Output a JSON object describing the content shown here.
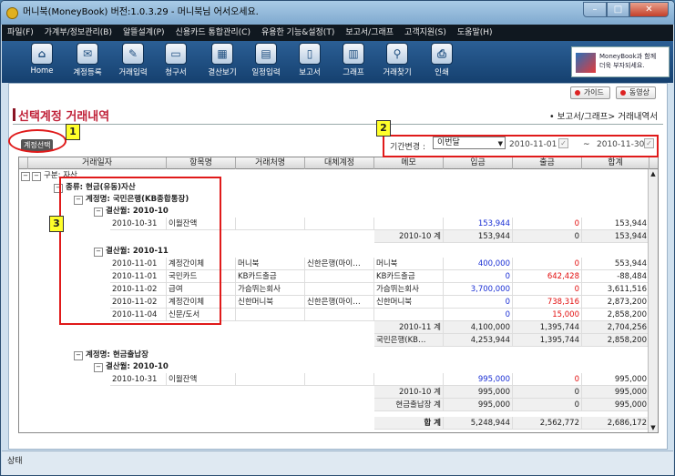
{
  "window": {
    "title": "머니북(MoneyBook) 버전:1.0.3.29 - 머니북님 어서오세요."
  },
  "menu": [
    "파일(F)",
    "가계부/정보관리(B)",
    "알뜰설계(P)",
    "신용카드 통합관리(C)",
    "유용한 기능&설정(T)",
    "보고서/그래프",
    "고객지원(S)",
    "도움말(H)"
  ],
  "toolbar": [
    {
      "label": "Home",
      "icon": "home-icon"
    },
    {
      "label": "계정등록",
      "icon": "account-register-icon"
    },
    {
      "label": "거래입력",
      "icon": "transaction-entry-icon"
    },
    {
      "label": "청구서",
      "icon": "bill-icon"
    },
    {
      "label": "결산보기",
      "icon": "settlement-icon"
    },
    {
      "label": "일정입력",
      "icon": "calendar-icon"
    },
    {
      "label": "보고서",
      "icon": "report-icon"
    },
    {
      "label": "그래프",
      "icon": "graph-icon"
    },
    {
      "label": "거래찾기",
      "icon": "search-icon"
    },
    {
      "label": "인쇄",
      "icon": "print-icon"
    }
  ],
  "banner": {
    "line1": "MoneyBook과 함께",
    "line2": "더욱 부자되세요."
  },
  "topbuttons": {
    "guide": "가이드",
    "video": "동영상"
  },
  "page": {
    "title": "선택계정 거래내역",
    "breadcrumb": "• 보고서/그래프> 거래내역서"
  },
  "filters": {
    "account_select": "계정선택",
    "period_label": "기간변경 :",
    "period_value": "이번달",
    "date_from": "2010-11-01",
    "tilde": "~",
    "date_to": "2010-11-30"
  },
  "columns": [
    "거래일자",
    "항목명",
    "거래처명",
    "대체계정",
    "메모",
    "입금",
    "출금",
    "합계"
  ],
  "groups": {
    "division": "구분: 자산",
    "type": "종류: 현금(유동)자산",
    "acct1": "계정명: 국민은행(KB종합통장)",
    "month_oct": "결산월: 2010-10",
    "month_nov": "결산월: 2010-11",
    "acct2": "계정명: 현금출납장",
    "month_oct2": "결산월: 2010-10"
  },
  "rows_oct": [
    {
      "date": "2010-10-31",
      "item": "이월잔액",
      "vendor": "",
      "alt": "",
      "memo": "",
      "in": "153,944",
      "out": "0",
      "sum": "153,944"
    }
  ],
  "total_oct": {
    "label": "2010-10 계",
    "in": "153,944",
    "out": "0",
    "sum": "153,944"
  },
  "rows_nov": [
    {
      "date": "2010-11-01",
      "item": "계정간이체",
      "vendor": "머니북",
      "alt": "신한은행(마이…",
      "memo": "머니북",
      "in": "400,000",
      "out": "0",
      "sum": "553,944"
    },
    {
      "date": "2010-11-01",
      "item": "국민카드",
      "vendor": "KB카드출금",
      "alt": "",
      "memo": "KB카드출금",
      "in": "0",
      "out": "642,428",
      "sum": "-88,484"
    },
    {
      "date": "2010-11-02",
      "item": "급여",
      "vendor": "가슴뛰는회사",
      "alt": "",
      "memo": "가슴뛰는회사",
      "in": "3,700,000",
      "out": "0",
      "sum": "3,611,516"
    },
    {
      "date": "2010-11-02",
      "item": "계정간이체",
      "vendor": "신한머니북",
      "alt": "신한은행(마이…",
      "memo": "신한머니북",
      "in": "0",
      "out": "738,316",
      "sum": "2,873,200"
    },
    {
      "date": "2010-11-04",
      "item": "신문/도서",
      "vendor": "",
      "alt": "",
      "memo": "",
      "in": "0",
      "out": "15,000",
      "sum": "2,858,200"
    }
  ],
  "total_nov": {
    "label": "2010-11 계",
    "in": "4,100,000",
    "out": "1,395,744",
    "sum": "2,704,256"
  },
  "total_acct1": {
    "label": "국민은행(KB…",
    "in": "4,253,944",
    "out": "1,395,744",
    "sum": "2,858,200"
  },
  "rows_cash": [
    {
      "date": "2010-10-31",
      "item": "이월잔액",
      "vendor": "",
      "alt": "",
      "memo": "",
      "in": "995,000",
      "out": "0",
      "sum": "995,000"
    }
  ],
  "total_cash_oct": {
    "label": "2010-10 계",
    "in": "995,000",
    "out": "0",
    "sum": "995,000"
  },
  "total_acct2": {
    "label": "현금출납장 계",
    "in": "995,000",
    "out": "0",
    "sum": "995,000"
  },
  "grand_total": {
    "label": "합 계",
    "in": "5,248,944",
    "out": "2,562,772",
    "sum": "2,686,172"
  },
  "annotations": [
    "1",
    "2",
    "3"
  ],
  "status": "상태"
}
